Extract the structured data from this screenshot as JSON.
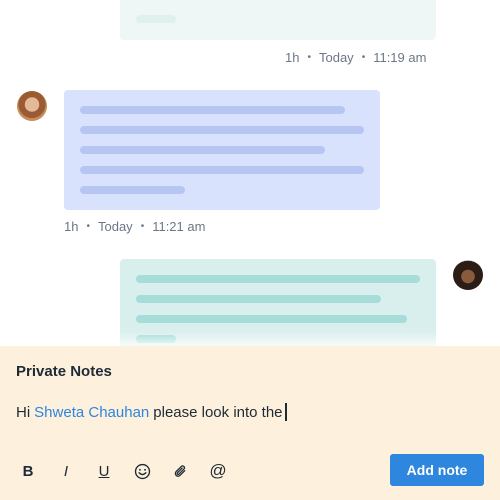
{
  "messages": [
    {
      "id": "top",
      "meta": {
        "ago": "1h",
        "day": "Today",
        "time": "11:19 am"
      }
    },
    {
      "id": "left",
      "meta": {
        "ago": "1h",
        "day": "Today",
        "time": "11:21 am"
      }
    },
    {
      "id": "right"
    }
  ],
  "notes": {
    "title": "Private Notes",
    "text_before": "Hi",
    "mention": "Shweta Chauhan",
    "text_after": "please look into the"
  },
  "toolbar": {
    "bold": "B",
    "italic": "I",
    "underline": "U",
    "emoji_icon": "smiley-icon",
    "attach_icon": "paperclip-icon",
    "mention_icon": "at-icon",
    "mention_glyph": "@",
    "add_note_label": "Add note"
  },
  "colors": {
    "accent": "#2e86de",
    "notes_bg": "#fdf0dc",
    "bubble_blue": "#d8e2fd",
    "bubble_teal": "#d9efee"
  }
}
